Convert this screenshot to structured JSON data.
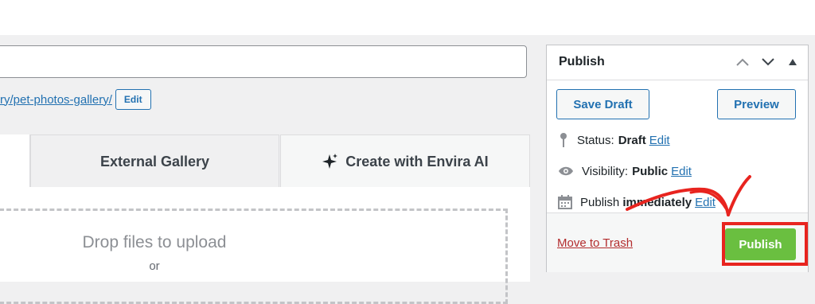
{
  "editor": {
    "permalink_text": "ry/pet-photos-gallery/",
    "permalink_edit_label": "Edit"
  },
  "tabs": [
    {
      "label": ""
    },
    {
      "label": "External Gallery"
    },
    {
      "label": "Create with Envira AI"
    }
  ],
  "upload": {
    "drop_text": "Drop files to upload",
    "or_text": "or"
  },
  "publish_box": {
    "title": "Publish",
    "save_draft_label": "Save Draft",
    "preview_label": "Preview",
    "status_label": "Status:",
    "status_value": "Draft",
    "visibility_label": "Visibility:",
    "visibility_value": "Public",
    "schedule_prefix": "Publish ",
    "schedule_value": "immediately",
    "edit_label": "Edit",
    "trash_label": "Move to Trash",
    "publish_label": "Publish"
  },
  "colors": {
    "accent": "#2271b1",
    "publish_green": "#6abf40",
    "annotation_red": "#e8241f",
    "trash_red": "#b32d2e"
  }
}
